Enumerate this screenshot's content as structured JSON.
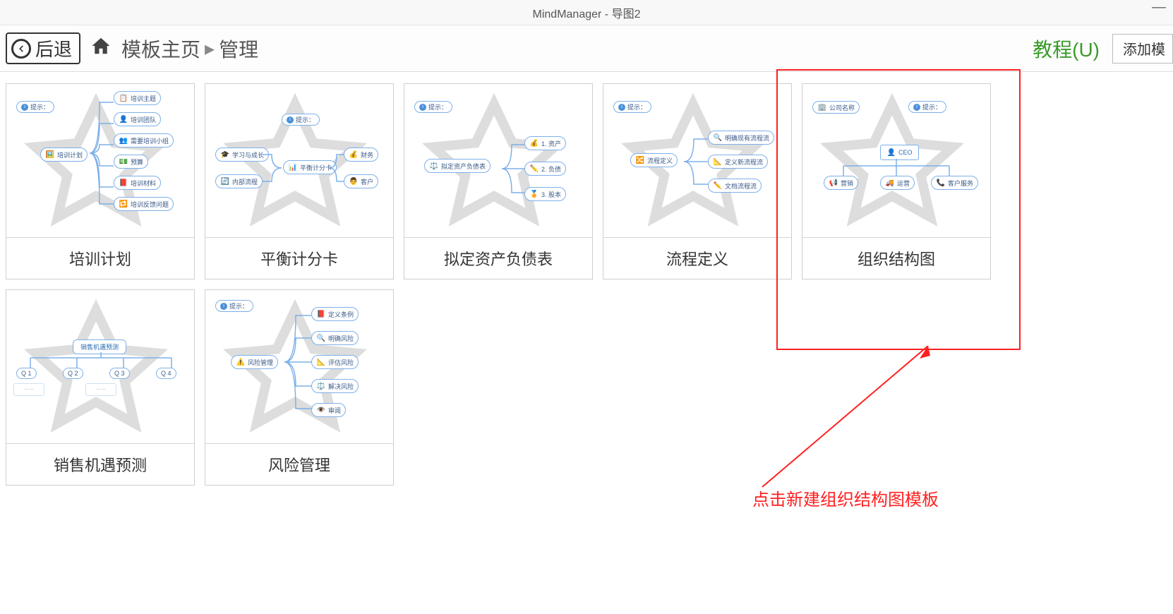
{
  "title": "MindManager - 导图2",
  "toolbar": {
    "back_label": "后退",
    "breadcrumb_root": "模板主页",
    "breadcrumb_current": "管理",
    "tutorial_label": "教程(U)",
    "add_template_label": "添加模"
  },
  "templates": [
    {
      "id": "training-plan",
      "label": "培训计划",
      "tip": "提示：",
      "root": "培训计划",
      "children": [
        "培训主题",
        "培训团队",
        "需要培训小组",
        "预算",
        "培训材料",
        "培训反馈问题"
      ]
    },
    {
      "id": "balanced-scorecard",
      "label": "平衡计分卡",
      "tip": "提示：",
      "root": "平衡计分卡",
      "left": [
        "学习与成长",
        "内部流程"
      ],
      "right": [
        "财务",
        "客户"
      ]
    },
    {
      "id": "balance-sheet",
      "label": "拟定资产负债表",
      "tip": "提示：",
      "root": "拟定资产负债表",
      "children": [
        "1. 资产",
        "2. 负债",
        "3. 股本"
      ]
    },
    {
      "id": "process-def",
      "label": "流程定义",
      "tip": "提示：",
      "root": "流程定义",
      "children": [
        "明确现有流程流",
        "定义新流程流",
        "文档流程流"
      ]
    },
    {
      "id": "org-chart",
      "label": "组织结构图",
      "tip": "提示：",
      "company": "公司名称",
      "ceo": "CEO",
      "children": [
        "营销",
        "运营",
        "客户服务"
      ]
    },
    {
      "id": "sales-forecast",
      "label": "销售机遇预测",
      "root": "销售机遇预测",
      "quarters": [
        "Q 1",
        "Q 2",
        "Q 3",
        "Q 4"
      ]
    },
    {
      "id": "risk-mgmt",
      "label": "风险管理",
      "tip": "提示：",
      "root": "风险管理",
      "children": [
        "定义条例",
        "明确风险",
        "评估风险",
        "解决风险",
        "审阅"
      ]
    }
  ],
  "annotation": {
    "text": "点击新建组织结构图模板"
  }
}
